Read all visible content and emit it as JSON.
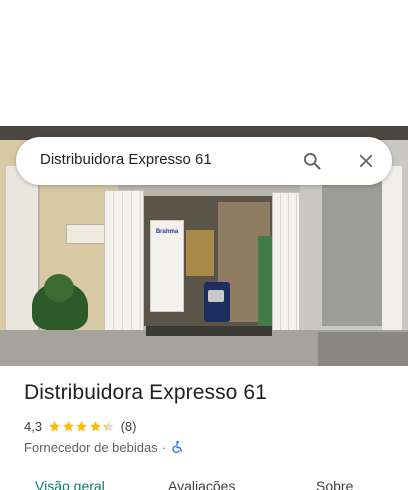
{
  "search": {
    "query": "Distribuidora Expresso 61",
    "search_icon": "search-icon",
    "close_icon": "close-icon"
  },
  "place": {
    "name": "Distribuidora Expresso 61",
    "rating": "4,3",
    "rating_stars": 4.3,
    "reviews": "(8)",
    "category": "Fornecedor de bebidas",
    "separator": "·",
    "accessibility_icon": "wheelchair-accessible-icon"
  },
  "photo": {
    "sign_text": "Brahma"
  },
  "tabs": [
    {
      "label": "Visão geral",
      "active": true
    },
    {
      "label": "Avaliações",
      "active": false
    },
    {
      "label": "Sobre",
      "active": false
    }
  ],
  "colors": {
    "star": "#fbbc04",
    "active_tab": "#0b7a6e",
    "accessible_icon": "#1a73e8"
  }
}
